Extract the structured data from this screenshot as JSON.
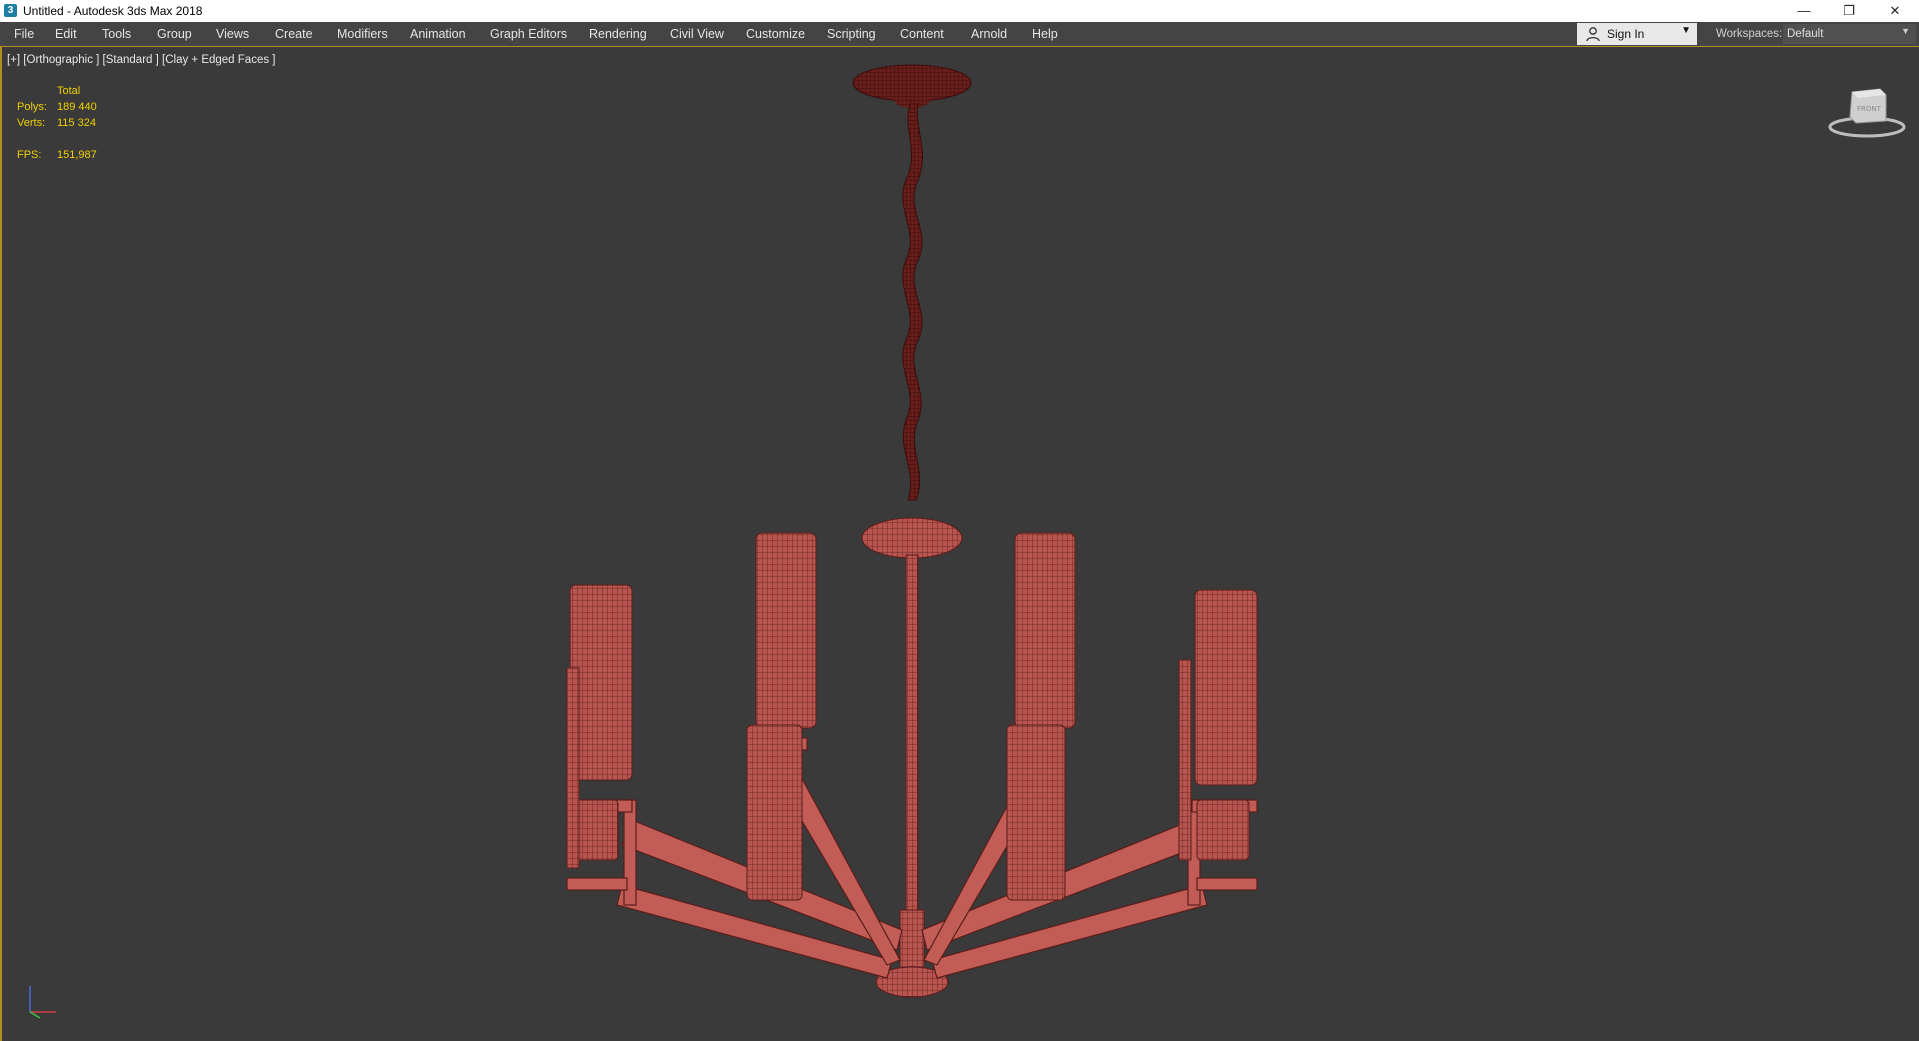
{
  "window": {
    "title": "Untitled - Autodesk 3ds Max 2018",
    "app_icon": "3ds-max-icon"
  },
  "menu": {
    "items": [
      "File",
      "Edit",
      "Tools",
      "Group",
      "Views",
      "Create",
      "Modifiers",
      "Animation",
      "Graph Editors",
      "Rendering",
      "Civil View",
      "Customize",
      "Scripting",
      "Content",
      "Arnold",
      "Help"
    ]
  },
  "account": {
    "signin_label": "Sign In"
  },
  "workspaces": {
    "label": "Workspaces:",
    "value": "Default"
  },
  "viewport": {
    "label": "[+] [Orthographic ] [Standard ] [Clay + Edged Faces ]",
    "stats": {
      "total_label": "Total",
      "polys_label": "Polys:",
      "polys_value": "189 440",
      "verts_label": "Verts:",
      "verts_value": "115 324",
      "fps_label": "FPS:",
      "fps_value": "151,987"
    },
    "viewcube_face": "FRONT"
  },
  "colors": {
    "accent": "#b38f22",
    "stats_text": "#f0d000",
    "model_fill": "#b85550",
    "model_wire": "#5a1d1a",
    "viewport_bg": "#3a3a3a"
  }
}
